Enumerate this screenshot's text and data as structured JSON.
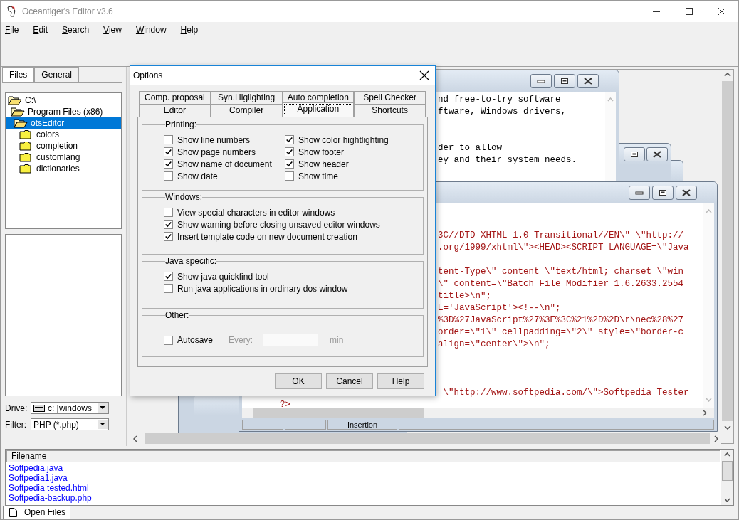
{
  "window": {
    "title": "Oceantiger's Editor v3.6"
  },
  "menu": [
    "File",
    "Edit",
    "Search",
    "View",
    "Window",
    "Help"
  ],
  "sidebar": {
    "tabs": [
      {
        "label": "Files",
        "selected": true
      },
      {
        "label": "General",
        "selected": false
      }
    ],
    "tree": [
      {
        "label": "C:\\",
        "selected": false,
        "expanded": true,
        "children": [
          {
            "label": "Program Files (x86)",
            "selected": false,
            "expanded": true,
            "children": [
              {
                "label": "otsEditor",
                "selected": true,
                "expanded": true,
                "children": [
                  {
                    "label": "colors",
                    "selected": false,
                    "expanded": false
                  },
                  {
                    "label": "completion",
                    "selected": false,
                    "expanded": false
                  },
                  {
                    "label": "customlang",
                    "selected": false,
                    "expanded": false
                  },
                  {
                    "label": "dictionaries",
                    "selected": false,
                    "expanded": false
                  }
                ]
              }
            ]
          }
        ]
      }
    ],
    "drive": {
      "label": "Drive:",
      "value": "c: [windows"
    },
    "filter": {
      "label": "Filter:",
      "value": "PHP (*.php)"
    }
  },
  "editor_windows": [
    {
      "lines": [
        {
          "kind": "fragment",
          "text": "nd free-to-try software"
        },
        {
          "kind": "fragment",
          "text": "ftware, Windows drivers,"
        },
        {
          "kind": "blank"
        },
        {
          "kind": "blank"
        },
        {
          "kind": "fragment",
          "text": "der to allow"
        },
        {
          "kind": "fragment",
          "text": "ey and their system needs."
        }
      ]
    },
    {
      "lines": [
        {
          "kind": "blank"
        },
        {
          "kind": "blank"
        },
        {
          "kind": "fragment",
          "text": "3C//DTD XHTML 1.0 Transitional//EN\\\" \\\"http://"
        },
        {
          "kind": "fragment",
          "text": ".org/1999/xhtml\\\"><HEAD><SCRIPT LANGUAGE=\\\"Java"
        },
        {
          "kind": "blank"
        },
        {
          "kind": "fragment",
          "text": "tent-Type\\\" content=\\\"text/html; charset=\\\"win"
        },
        {
          "kind": "fragment",
          "text": "\\\" content=\\\"Batch File Modifier 1.6.2633.2554"
        },
        {
          "kind": "fragment",
          "text": "title>\\n\";"
        },
        {
          "kind": "fragment",
          "text": "E='JavaScript'><!--\\n\";"
        },
        {
          "kind": "fragment",
          "text": "%3D%27JavaScript%27%3E%3C%21%2D%2D\\r\\nec%28%27"
        },
        {
          "kind": "fragment",
          "text": "order=\\\"1\\\" cellpadding=\\\"2\\\" style=\\\"border-c"
        },
        {
          "kind": "fragment",
          "text": "align=\\\"center\\\">\\n\";"
        },
        {
          "kind": "blank"
        },
        {
          "kind": "blank"
        },
        {
          "kind": "blank"
        },
        {
          "kind": "fragment",
          "text": "=\\\"http://www.softpedia.com/\\\">Softpedia Tester"
        },
        {
          "kind": "full",
          "text": "?>"
        }
      ],
      "status": {
        "mode": "Insertion"
      }
    }
  ],
  "dialog": {
    "title": "Options",
    "tab_rows": [
      [
        {
          "label": "Comp. proposal",
          "selected": false
        },
        {
          "label": "Syn.Higlighting",
          "selected": false
        },
        {
          "label": "Auto completion",
          "selected": false
        },
        {
          "label": "Spell Checker",
          "selected": false
        }
      ],
      [
        {
          "label": "Editor",
          "selected": false
        },
        {
          "label": "Compiler",
          "selected": false
        },
        {
          "label": "Application",
          "selected": true
        },
        {
          "label": "Shortcuts",
          "selected": false
        }
      ]
    ],
    "groups": [
      {
        "title": "Printing:",
        "columns": [
          [
            {
              "label": "Show line numbers",
              "checked": false
            },
            {
              "label": "Show page numbers",
              "checked": true
            },
            {
              "label": "Show name of document",
              "checked": true
            },
            {
              "label": "Show date",
              "checked": false
            }
          ],
          [
            {
              "label": "Show color hightlighting",
              "checked": true
            },
            {
              "label": "Show footer",
              "checked": true
            },
            {
              "label": "Show header",
              "checked": true
            },
            {
              "label": "Show time",
              "checked": false
            }
          ]
        ]
      },
      {
        "title": "Windows:",
        "columns": [
          [
            {
              "label": "View special characters in editor windows",
              "checked": false
            },
            {
              "label": "Show warning before closing unsaved editor windows",
              "checked": true
            },
            {
              "label": "Insert template code on new document creation",
              "checked": true
            }
          ]
        ]
      },
      {
        "title": "Java specific:",
        "columns": [
          [
            {
              "label": "Show java quickfind tool",
              "checked": true
            },
            {
              "label": "Run java applications in ordinary dos window",
              "checked": false
            }
          ]
        ]
      }
    ],
    "other": {
      "title": "Other:",
      "autosave": {
        "label": "Autosave",
        "checked": false
      },
      "interval": {
        "label": "Every:",
        "unit": "min",
        "disabled": true
      }
    },
    "buttons": [
      "OK",
      "Cancel",
      "Help"
    ]
  },
  "file_list": {
    "header": "Filename",
    "rows": [
      "Softpedia.java",
      "Softpedia1.java",
      "Softpedia tested.html",
      "Softpedia-backup.php"
    ]
  },
  "bottom_tabs": [
    {
      "label": "Open Files",
      "selected": true
    }
  ]
}
